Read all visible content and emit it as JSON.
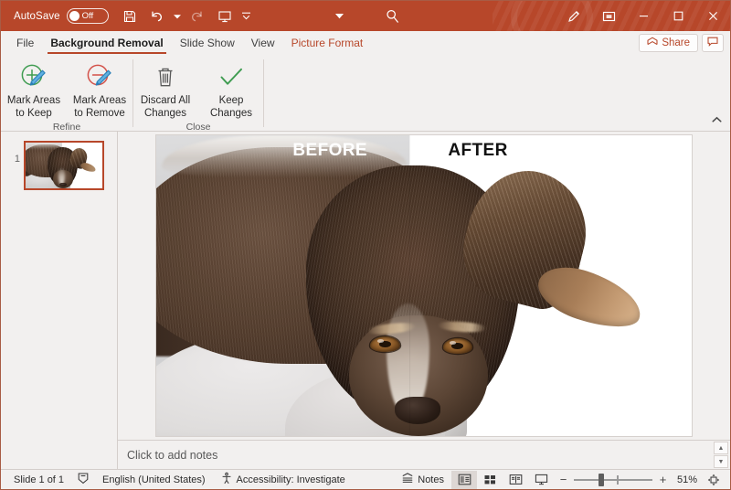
{
  "titlebar": {
    "autosave_label": "AutoSave",
    "autosave_state": "Off",
    "buttons": [
      {
        "name": "save-icon",
        "tip": "Save"
      },
      {
        "name": "undo-icon",
        "tip": "Undo"
      },
      {
        "name": "undo-dropdown-icon",
        "tip": "Undo options"
      },
      {
        "name": "redo-icon",
        "tip": "Redo"
      },
      {
        "name": "start-presentation-icon",
        "tip": "Start From Beginning"
      },
      {
        "name": "customize-quick-access-toolbar-icon",
        "tip": "Customize Quick Access Toolbar"
      }
    ],
    "ribbon_display_options": "ribbon-display-options-icon",
    "search_icon": "search-icon",
    "pen_icon": "pen-icon",
    "present_icon": "present-icon",
    "minimize_icon": "minimize-icon",
    "maximize_icon": "maximize-icon",
    "close_icon": "close-icon"
  },
  "tabs": [
    {
      "label": "File",
      "active": false,
      "accent": false
    },
    {
      "label": "Background Removal",
      "active": true,
      "accent": false
    },
    {
      "label": "Slide Show",
      "active": false,
      "accent": false
    },
    {
      "label": "View",
      "active": false,
      "accent": false
    },
    {
      "label": "Picture Format",
      "active": false,
      "accent": true
    }
  ],
  "tabbar_right": {
    "share_label": "Share",
    "share_icon": "share-icon",
    "comment_icon": "comment-icon"
  },
  "ribbon": {
    "groups": [
      {
        "label": "Refine",
        "buttons": [
          {
            "label_line1": "Mark Areas",
            "label_line2": "to Keep",
            "icon": "mark-areas-to-keep-icon"
          },
          {
            "label_line1": "Mark Areas",
            "label_line2": "to Remove",
            "icon": "mark-areas-to-remove-icon"
          }
        ]
      },
      {
        "label": "Close",
        "buttons": [
          {
            "label_line1": "Discard All",
            "label_line2": "Changes",
            "icon": "discard-all-changes-icon"
          },
          {
            "label_line1": "Keep",
            "label_line2": "Changes",
            "icon": "keep-changes-icon"
          }
        ]
      }
    ],
    "collapse_icon": "collapse-ribbon-icon"
  },
  "thumbnails": [
    {
      "number": "1",
      "selected": true
    }
  ],
  "slide": {
    "label_before": "BEFORE",
    "label_after": "AFTER",
    "image_name": "dog-photo-background-removal-preview"
  },
  "notes": {
    "placeholder": "Click to add notes",
    "scroll_up_icon": "scroll-up-icon",
    "scroll_down_icon": "scroll-down-icon"
  },
  "statusbar": {
    "slide_count": "Slide 1 of 1",
    "spellcheck_icon": "spellcheck-icon",
    "language": "English (United States)",
    "accessibility_icon": "accessibility-icon",
    "accessibility": "Accessibility: Investigate",
    "notes_label": "Notes",
    "notes_icon": "notes-icon",
    "views": [
      {
        "name": "normal-view-button",
        "selected": true
      },
      {
        "name": "slide-sorter-view-button",
        "selected": false
      },
      {
        "name": "reading-view-button",
        "selected": false
      },
      {
        "name": "slide-show-button",
        "selected": false
      }
    ],
    "zoom_out": "−",
    "zoom_in": "+",
    "zoom_percent": "51%",
    "fit_icon": "fit-slide-to-window-icon"
  },
  "colors": {
    "accent": "#b7472a",
    "ribbon_bg": "#f2f0ef",
    "keep_green": "#3f9c51",
    "remove_red": "#d35149",
    "pencil_blue": "#3d9bd4"
  }
}
